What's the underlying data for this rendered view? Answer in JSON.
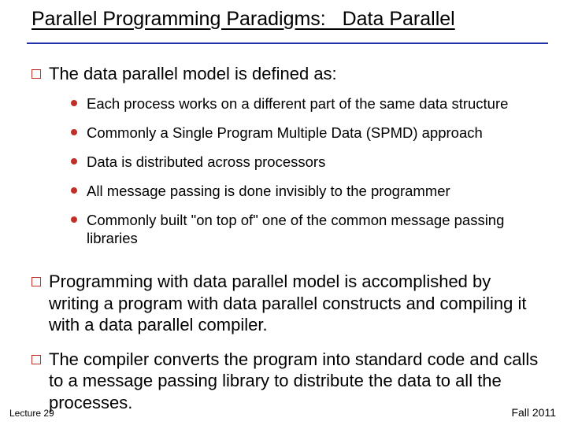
{
  "title": "Parallel Programming Paradigms:   Data Parallel",
  "points": {
    "p0": {
      "text": "The data parallel model is defined as:",
      "subs": {
        "s0": "Each process works on a different part of the same data structure",
        "s1": "Commonly a Single Program Multiple Data (SPMD) approach",
        "s2": "Data is distributed across processors",
        "s3": "All message passing is done invisibly to the programmer",
        "s4": "Commonly built \"on top of\" one of the common message passing libraries"
      }
    },
    "p1": {
      "text": "Programming with data parallel model is accomplished by writing a program with data parallel constructs and compiling it with a data parallel compiler."
    },
    "p2": {
      "text": "The compiler converts the program into standard code and calls to a message passing library to distribute the data to all the processes."
    }
  },
  "footer": {
    "left": "Lecture 29",
    "right": "Fall 2011"
  }
}
